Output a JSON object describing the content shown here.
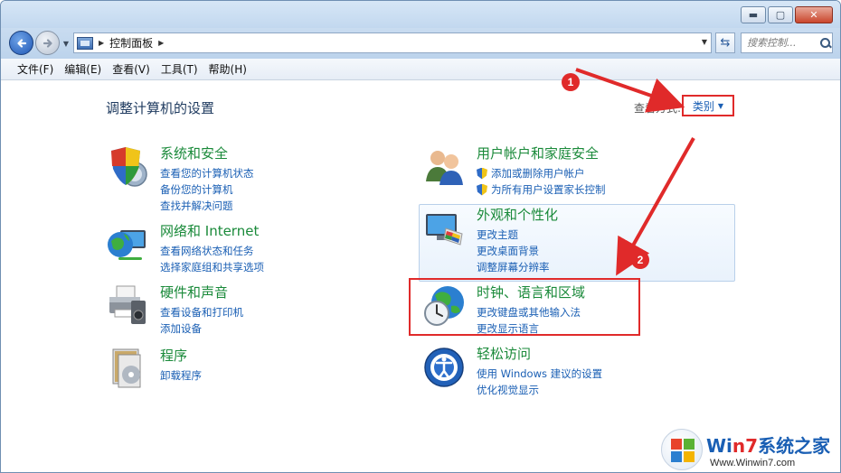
{
  "window": {
    "buttons": {
      "minimize": "▬",
      "maximize": "▢",
      "close": "✕"
    }
  },
  "address": {
    "path": "控制面板",
    "refresh_icon": "refresh-icon",
    "search_placeholder": "搜索控制..."
  },
  "menu": [
    "文件(F)",
    "编辑(E)",
    "查看(V)",
    "工具(T)",
    "帮助(H)"
  ],
  "main": {
    "title": "调整计算机的设置",
    "view_by_label": "查看方式:",
    "view_by_value": "类别"
  },
  "categories_left": [
    {
      "title": "系统和安全",
      "icon": "shield-icon",
      "links": [
        "查看您的计算机状态",
        "备份您的计算机",
        "查找并解决问题"
      ]
    },
    {
      "title": "网络和 Internet",
      "icon": "network-icon",
      "links": [
        "查看网络状态和任务",
        "选择家庭组和共享选项"
      ]
    },
    {
      "title": "硬件和声音",
      "icon": "printer-icon",
      "links": [
        "查看设备和打印机",
        "添加设备"
      ]
    },
    {
      "title": "程序",
      "icon": "programs-icon",
      "links": [
        "卸载程序"
      ]
    }
  ],
  "categories_right": [
    {
      "title": "用户帐户和家庭安全",
      "icon": "users-icon",
      "links": [
        "添加或删除用户帐户",
        "为所有用户设置家长控制"
      ]
    },
    {
      "title": "外观和个性化",
      "icon": "appearance-icon",
      "links": [
        "更改主题",
        "更改桌面背景",
        "调整屏幕分辨率"
      ]
    },
    {
      "title": "时钟、语言和区域",
      "icon": "clock-globe-icon",
      "links": [
        "更改键盘或其他输入法",
        "更改显示语言"
      ]
    },
    {
      "title": "轻松访问",
      "icon": "ease-of-access-icon",
      "links": [
        "使用 Windows 建议的设置",
        "优化视觉显示"
      ]
    }
  ],
  "annotations": {
    "badge1": "1",
    "badge2": "2",
    "color": "#e02a2a"
  },
  "watermark": {
    "title_prefix": "Wi",
    "title_seven": "n7",
    "title_suffix": "系统之家",
    "url": "Www.Winwin7.com"
  }
}
